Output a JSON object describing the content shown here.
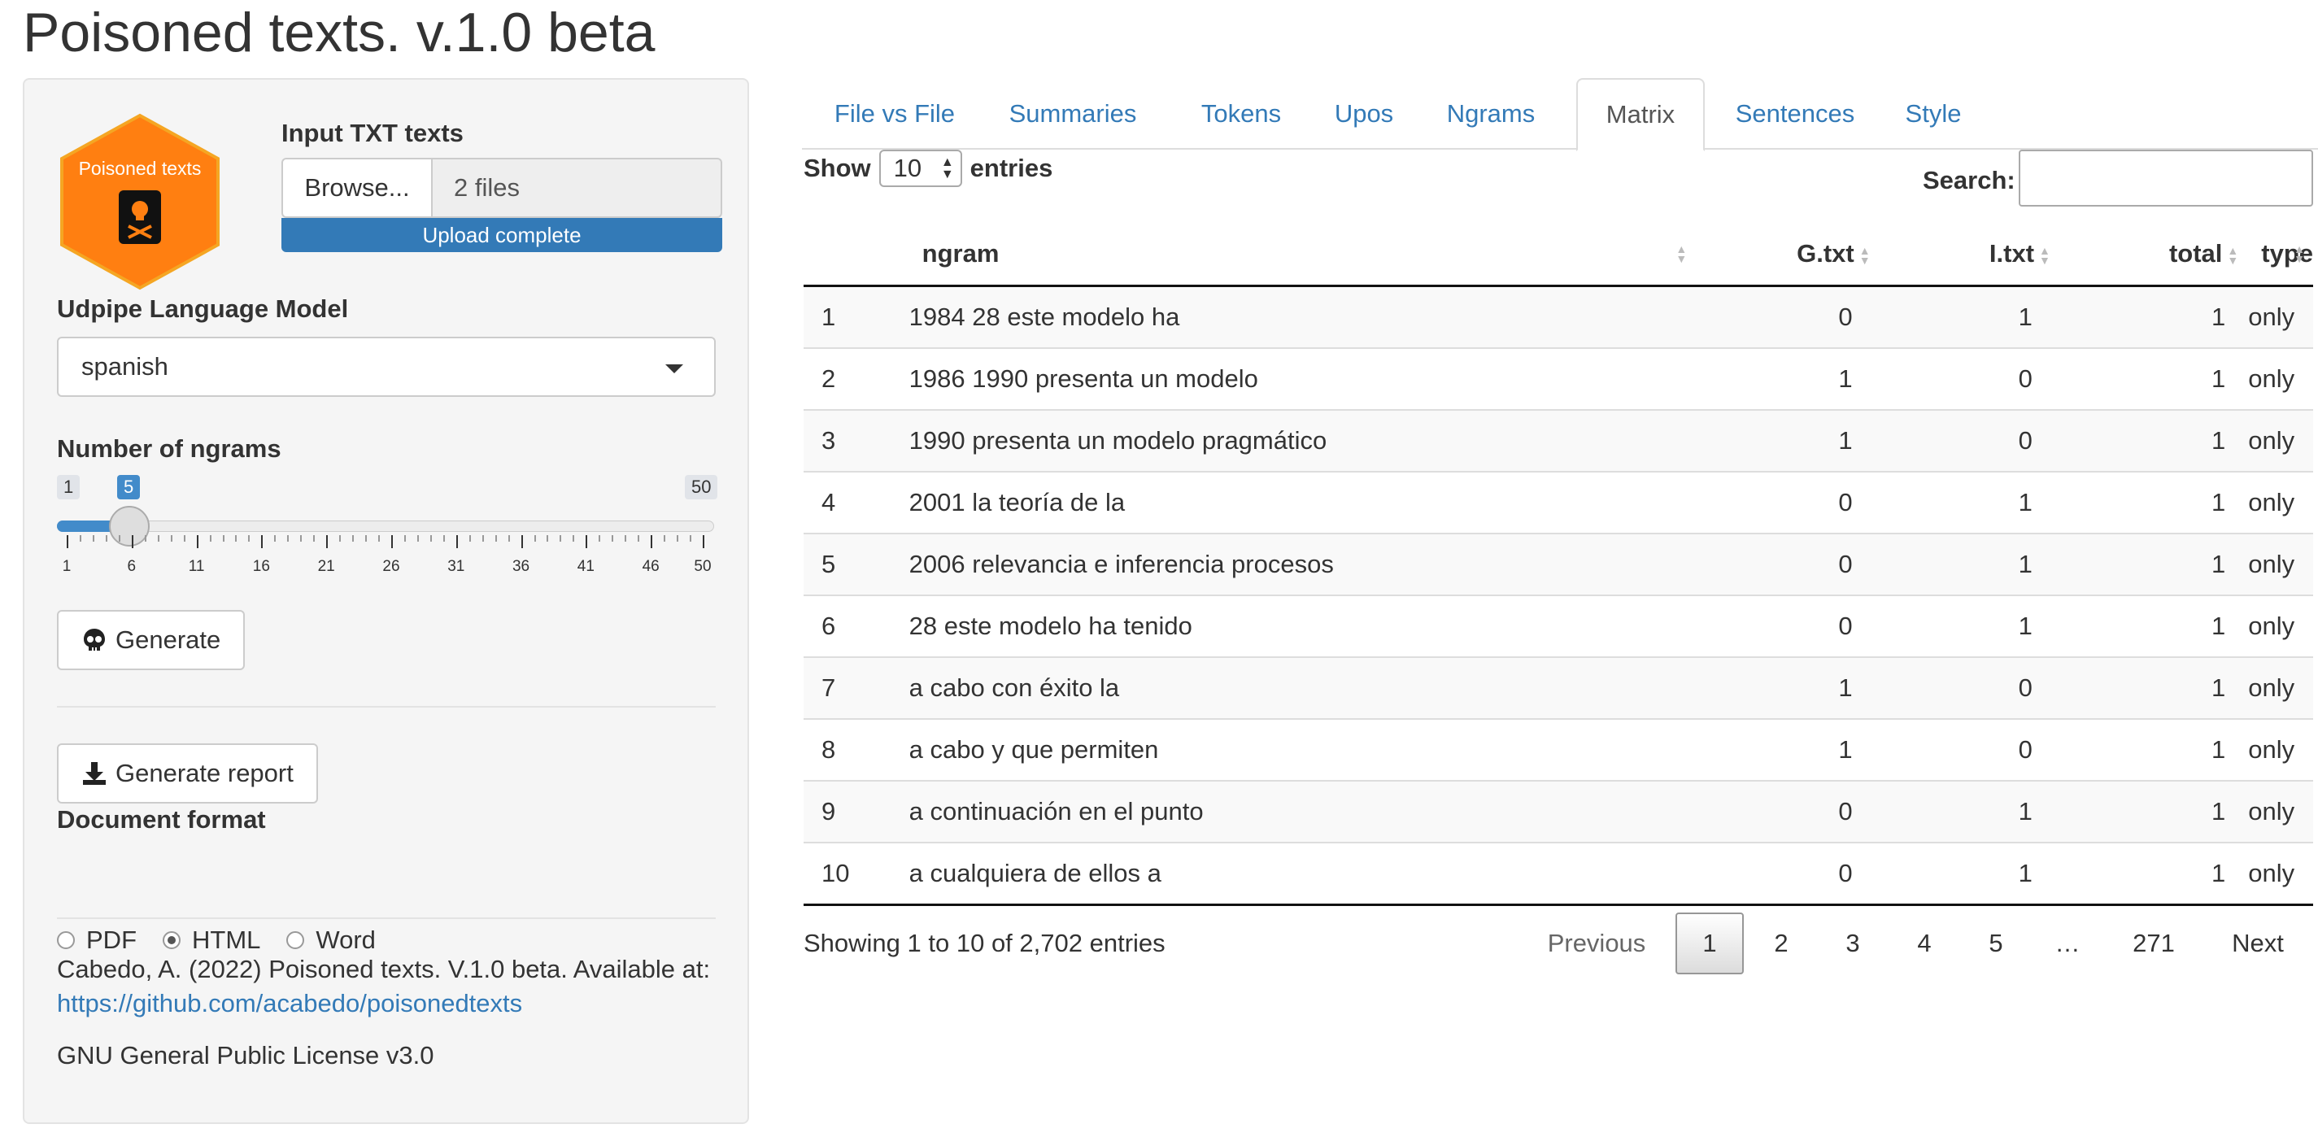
{
  "app": {
    "title": "Poisoned texts. v.1.0 beta"
  },
  "sidebar": {
    "logo_text": "Poisoned texts",
    "input_label": "Input TXT texts",
    "browse_label": "Browse...",
    "file_value": "2 files",
    "upload_status": "Upload complete",
    "model_label": "Udpipe Language Model",
    "model_value": "spanish",
    "ngrams_label": "Number of ngrams",
    "slider": {
      "min": "1",
      "max": "50",
      "value": "5",
      "ticks": [
        "1",
        "6",
        "11",
        "16",
        "21",
        "26",
        "31",
        "36",
        "41",
        "46",
        "50"
      ]
    },
    "generate_label": "Generate",
    "report_label": "Generate report",
    "format_label": "Document format",
    "formats": [
      "PDF",
      "HTML",
      "Word"
    ],
    "selected_format": "HTML",
    "citation": "Cabedo, A. (2022) Poisoned texts. V.1.0 beta. Available at:",
    "citation_link": "https://github.com/acabedo/poisonedtexts",
    "license": "GNU General Public License v3.0"
  },
  "tabs": [
    "File vs File",
    "Summaries",
    "Tokens",
    "Upos",
    "Ngrams",
    "Matrix",
    "Sentences",
    "Style"
  ],
  "active_tab": "Matrix",
  "table": {
    "show_label": "Show",
    "entries_value": "10",
    "entries_label": "entries",
    "search_label": "Search:",
    "columns": [
      "",
      "ngram",
      "G.txt",
      "I.txt",
      "total",
      "type"
    ],
    "rows": [
      [
        "1",
        "1984 28 este modelo ha",
        "0",
        "1",
        "1",
        "only"
      ],
      [
        "2",
        "1986 1990 presenta un modelo",
        "1",
        "0",
        "1",
        "only"
      ],
      [
        "3",
        "1990 presenta un modelo pragmático",
        "1",
        "0",
        "1",
        "only"
      ],
      [
        "4",
        "2001 la teoría de la",
        "0",
        "1",
        "1",
        "only"
      ],
      [
        "5",
        "2006 relevancia e inferencia procesos",
        "0",
        "1",
        "1",
        "only"
      ],
      [
        "6",
        "28 este modelo ha tenido",
        "0",
        "1",
        "1",
        "only"
      ],
      [
        "7",
        "a cabo con éxito la",
        "1",
        "0",
        "1",
        "only"
      ],
      [
        "8",
        "a cabo y que permiten",
        "1",
        "0",
        "1",
        "only"
      ],
      [
        "9",
        "a continuación en el punto",
        "0",
        "1",
        "1",
        "only"
      ],
      [
        "10",
        "a cualquiera de ellos a",
        "0",
        "1",
        "1",
        "only"
      ]
    ],
    "info": "Showing 1 to 10 of 2,702 entries",
    "pagination": {
      "previous": "Previous",
      "pages": [
        "1",
        "2",
        "3",
        "4",
        "5",
        "…",
        "271"
      ],
      "current": "1",
      "next": "Next"
    }
  },
  "colors": {
    "logo_orange": "#ff7f11",
    "accent_blue": "#337ab7",
    "slider_blue": "#428bca"
  }
}
